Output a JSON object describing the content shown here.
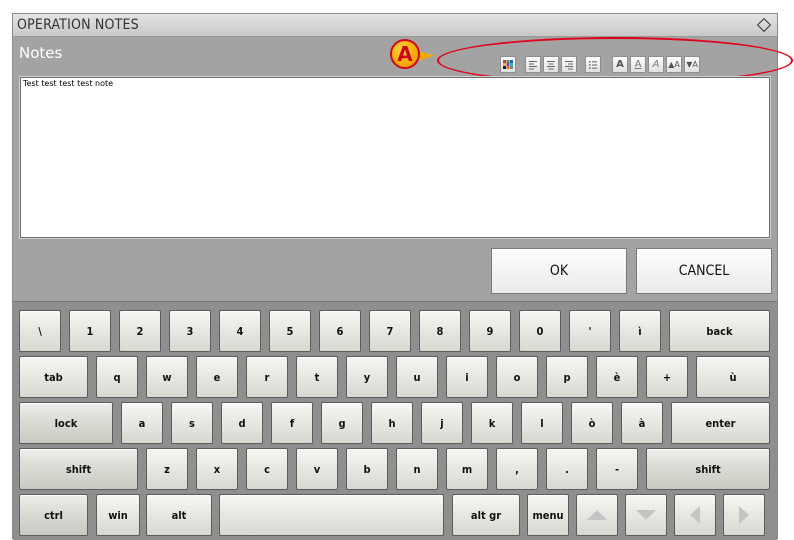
{
  "window": {
    "title": "OPERATION NOTES"
  },
  "notes": {
    "label": "Notes",
    "text": "Test test test test note"
  },
  "callout": {
    "label": "A"
  },
  "toolbar": [
    "color-palette-icon",
    "align-left-icon",
    "align-center-icon",
    "align-right-icon",
    "bullet-list-icon",
    "bold-icon",
    "underline-icon",
    "italic-icon",
    "font-increase-icon",
    "font-decrease-icon"
  ],
  "dialog": {
    "ok_label": "OK",
    "cancel_label": "CANCEL"
  },
  "keyboard": {
    "row1": [
      "\\",
      "1",
      "2",
      "3",
      "4",
      "5",
      "6",
      "7",
      "8",
      "9",
      "0",
      "'",
      "ì",
      "back"
    ],
    "row2": [
      "tab",
      "q",
      "w",
      "e",
      "r",
      "t",
      "y",
      "u",
      "i",
      "o",
      "p",
      "è",
      "+",
      "ù"
    ],
    "row3": [
      "lock",
      "a",
      "s",
      "d",
      "f",
      "g",
      "h",
      "j",
      "k",
      "l",
      "ò",
      "à",
      "enter"
    ],
    "row4": [
      "shift",
      "z",
      "x",
      "c",
      "v",
      "b",
      "n",
      "m",
      ",",
      ".",
      "-",
      "shift"
    ],
    "row5": [
      "ctrl",
      "win",
      "alt",
      "",
      "alt gr",
      "menu"
    ]
  }
}
